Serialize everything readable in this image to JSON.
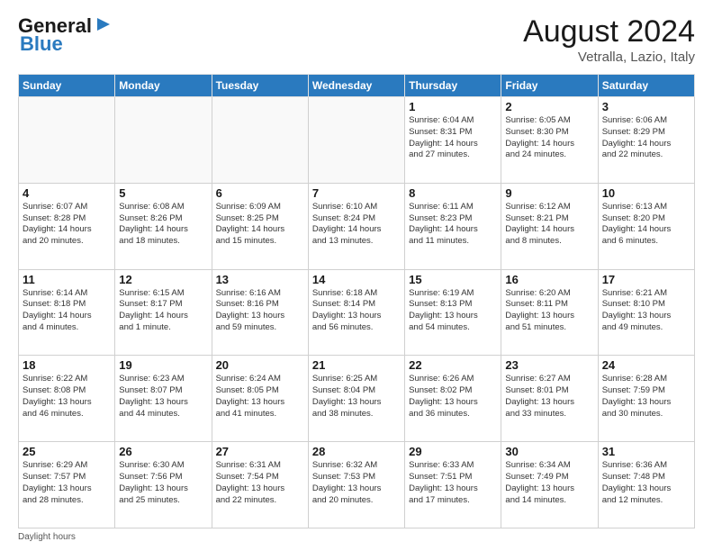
{
  "logo": {
    "line1": "General",
    "line2": "Blue"
  },
  "header": {
    "month_year": "August 2024",
    "location": "Vetralla, Lazio, Italy"
  },
  "weekdays": [
    "Sunday",
    "Monday",
    "Tuesday",
    "Wednesday",
    "Thursday",
    "Friday",
    "Saturday"
  ],
  "weeks": [
    [
      {
        "day": "",
        "info": ""
      },
      {
        "day": "",
        "info": ""
      },
      {
        "day": "",
        "info": ""
      },
      {
        "day": "",
        "info": ""
      },
      {
        "day": "1",
        "info": "Sunrise: 6:04 AM\nSunset: 8:31 PM\nDaylight: 14 hours\nand 27 minutes."
      },
      {
        "day": "2",
        "info": "Sunrise: 6:05 AM\nSunset: 8:30 PM\nDaylight: 14 hours\nand 24 minutes."
      },
      {
        "day": "3",
        "info": "Sunrise: 6:06 AM\nSunset: 8:29 PM\nDaylight: 14 hours\nand 22 minutes."
      }
    ],
    [
      {
        "day": "4",
        "info": "Sunrise: 6:07 AM\nSunset: 8:28 PM\nDaylight: 14 hours\nand 20 minutes."
      },
      {
        "day": "5",
        "info": "Sunrise: 6:08 AM\nSunset: 8:26 PM\nDaylight: 14 hours\nand 18 minutes."
      },
      {
        "day": "6",
        "info": "Sunrise: 6:09 AM\nSunset: 8:25 PM\nDaylight: 14 hours\nand 15 minutes."
      },
      {
        "day": "7",
        "info": "Sunrise: 6:10 AM\nSunset: 8:24 PM\nDaylight: 14 hours\nand 13 minutes."
      },
      {
        "day": "8",
        "info": "Sunrise: 6:11 AM\nSunset: 8:23 PM\nDaylight: 14 hours\nand 11 minutes."
      },
      {
        "day": "9",
        "info": "Sunrise: 6:12 AM\nSunset: 8:21 PM\nDaylight: 14 hours\nand 8 minutes."
      },
      {
        "day": "10",
        "info": "Sunrise: 6:13 AM\nSunset: 8:20 PM\nDaylight: 14 hours\nand 6 minutes."
      }
    ],
    [
      {
        "day": "11",
        "info": "Sunrise: 6:14 AM\nSunset: 8:18 PM\nDaylight: 14 hours\nand 4 minutes."
      },
      {
        "day": "12",
        "info": "Sunrise: 6:15 AM\nSunset: 8:17 PM\nDaylight: 14 hours\nand 1 minute."
      },
      {
        "day": "13",
        "info": "Sunrise: 6:16 AM\nSunset: 8:16 PM\nDaylight: 13 hours\nand 59 minutes."
      },
      {
        "day": "14",
        "info": "Sunrise: 6:18 AM\nSunset: 8:14 PM\nDaylight: 13 hours\nand 56 minutes."
      },
      {
        "day": "15",
        "info": "Sunrise: 6:19 AM\nSunset: 8:13 PM\nDaylight: 13 hours\nand 54 minutes."
      },
      {
        "day": "16",
        "info": "Sunrise: 6:20 AM\nSunset: 8:11 PM\nDaylight: 13 hours\nand 51 minutes."
      },
      {
        "day": "17",
        "info": "Sunrise: 6:21 AM\nSunset: 8:10 PM\nDaylight: 13 hours\nand 49 minutes."
      }
    ],
    [
      {
        "day": "18",
        "info": "Sunrise: 6:22 AM\nSunset: 8:08 PM\nDaylight: 13 hours\nand 46 minutes."
      },
      {
        "day": "19",
        "info": "Sunrise: 6:23 AM\nSunset: 8:07 PM\nDaylight: 13 hours\nand 44 minutes."
      },
      {
        "day": "20",
        "info": "Sunrise: 6:24 AM\nSunset: 8:05 PM\nDaylight: 13 hours\nand 41 minutes."
      },
      {
        "day": "21",
        "info": "Sunrise: 6:25 AM\nSunset: 8:04 PM\nDaylight: 13 hours\nand 38 minutes."
      },
      {
        "day": "22",
        "info": "Sunrise: 6:26 AM\nSunset: 8:02 PM\nDaylight: 13 hours\nand 36 minutes."
      },
      {
        "day": "23",
        "info": "Sunrise: 6:27 AM\nSunset: 8:01 PM\nDaylight: 13 hours\nand 33 minutes."
      },
      {
        "day": "24",
        "info": "Sunrise: 6:28 AM\nSunset: 7:59 PM\nDaylight: 13 hours\nand 30 minutes."
      }
    ],
    [
      {
        "day": "25",
        "info": "Sunrise: 6:29 AM\nSunset: 7:57 PM\nDaylight: 13 hours\nand 28 minutes."
      },
      {
        "day": "26",
        "info": "Sunrise: 6:30 AM\nSunset: 7:56 PM\nDaylight: 13 hours\nand 25 minutes."
      },
      {
        "day": "27",
        "info": "Sunrise: 6:31 AM\nSunset: 7:54 PM\nDaylight: 13 hours\nand 22 minutes."
      },
      {
        "day": "28",
        "info": "Sunrise: 6:32 AM\nSunset: 7:53 PM\nDaylight: 13 hours\nand 20 minutes."
      },
      {
        "day": "29",
        "info": "Sunrise: 6:33 AM\nSunset: 7:51 PM\nDaylight: 13 hours\nand 17 minutes."
      },
      {
        "day": "30",
        "info": "Sunrise: 6:34 AM\nSunset: 7:49 PM\nDaylight: 13 hours\nand 14 minutes."
      },
      {
        "day": "31",
        "info": "Sunrise: 6:36 AM\nSunset: 7:48 PM\nDaylight: 13 hours\nand 12 minutes."
      }
    ]
  ],
  "footer": {
    "note": "Daylight hours"
  }
}
